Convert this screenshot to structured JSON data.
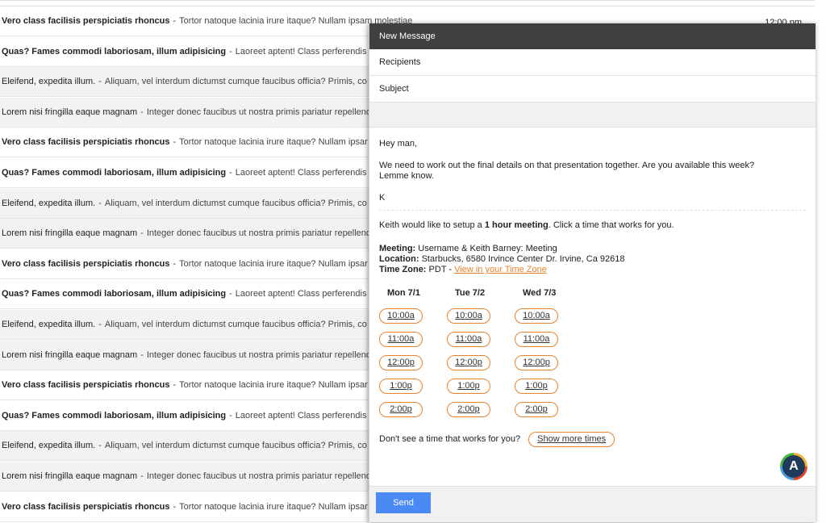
{
  "inbox": {
    "time_first": "12:00 pm",
    "rows": [
      {
        "subject": "Vero class facilisis perspiciatis rhoncus",
        "snippet": "Tortor natoque lacinia irure itaque? Nullam ipsam molestiae",
        "unread": true
      },
      {
        "subject": "Quas? Fames commodi laboriosam, illum adipisicing",
        "snippet": "Laoreet aptent! Class perferendis",
        "unread": true
      },
      {
        "subject": "Eleifend, expedita illum.",
        "snippet": "Aliquam, vel interdum dictumst cumque faucibus officia? Primis, co",
        "unread": false
      },
      {
        "subject": "Lorem nisi fringilla eaque magnam",
        "snippet": "Integer donec faucibus ut nostra primis pariatur repellend",
        "unread": false
      },
      {
        "subject": "Vero class facilisis perspiciatis rhoncus",
        "snippet": "Tortor natoque lacinia irure itaque? Nullam ipsar",
        "unread": true
      },
      {
        "subject": "Quas? Fames commodi laboriosam, illum adipisicing",
        "snippet": "Laoreet aptent! Class perferendis",
        "unread": true
      },
      {
        "subject": "Eleifend, expedita illum.",
        "snippet": "Aliquam, vel interdum dictumst cumque faucibus officia? Primis, co",
        "unread": false
      },
      {
        "subject": "Lorem nisi fringilla eaque magnam",
        "snippet": "Integer donec faucibus ut nostra primis pariatur repellend",
        "unread": false
      },
      {
        "subject": "Vero class facilisis perspiciatis rhoncus",
        "snippet": "Tortor natoque lacinia irure itaque? Nullam ipsar",
        "unread": true
      },
      {
        "subject": "Quas? Fames commodi laboriosam, illum adipisicing",
        "snippet": "Laoreet aptent! Class perferendis",
        "unread": true
      },
      {
        "subject": "Eleifend, expedita illum.",
        "snippet": "Aliquam, vel interdum dictumst cumque faucibus officia? Primis, co",
        "unread": false
      },
      {
        "subject": "Lorem nisi fringilla eaque magnam",
        "snippet": "Integer donec faucibus ut nostra primis pariatur repellend",
        "unread": false
      },
      {
        "subject": "Vero class facilisis perspiciatis rhoncus",
        "snippet": "Tortor natoque lacinia irure itaque? Nullam ipsar",
        "unread": true
      },
      {
        "subject": "Quas? Fames commodi laboriosam, illum adipisicing",
        "snippet": "Laoreet aptent! Class perferendis",
        "unread": true
      },
      {
        "subject": "Eleifend, expedita illum.",
        "snippet": "Aliquam, vel interdum dictumst cumque faucibus officia? Primis, co",
        "unread": false
      },
      {
        "subject": "Lorem nisi fringilla eaque magnam",
        "snippet": "Integer donec faucibus ut nostra primis pariatur repellend",
        "unread": false
      },
      {
        "subject": "Vero class facilisis perspiciatis rhoncus",
        "snippet": "Tortor natoque lacinia irure itaque? Nullam ipsar",
        "unread": true
      }
    ]
  },
  "compose": {
    "title": "New Message",
    "recipients_placeholder": "Recipients",
    "subject_placeholder": "Subject",
    "greeting": "Hey man,",
    "body_line": "We need to work out the final details on that presentation together. Are you available this week? Lemme know.",
    "signoff": "K",
    "invite_prefix": "Keith would like to setup a ",
    "invite_bold": "1 hour meeting",
    "invite_suffix": ". Click a time that works for you.",
    "meeting_label": "Meeting:",
    "meeting_value": "Username & Keith Barney: Meeting",
    "location_label": "Location:",
    "location_value": "Starbucks, 6580 Irvince Center Dr. Irvine, Ca 92618",
    "timezone_label": "Time Zone:",
    "timezone_value": "PDT -",
    "timezone_link": "View in your Time Zone",
    "days": [
      {
        "label": "Mon 7/1",
        "slots": [
          "10:00a",
          "11:00a",
          "12:00p",
          "1:00p",
          "2:00p"
        ]
      },
      {
        "label": "Tue 7/2",
        "slots": [
          "10:00a",
          "11:00a",
          "12:00p",
          "1:00p",
          "2:00p"
        ]
      },
      {
        "label": "Wed 7/3",
        "slots": [
          "10:00a",
          "11:00a",
          "12:00p",
          "1:00p",
          "2:00p"
        ]
      }
    ],
    "no_time_text": "Don't see a time that works for you?",
    "show_more_label": "Show more times",
    "send_label": "Send",
    "logo_letter": "A",
    "accent_color": "#e8822c",
    "send_color": "#4a8af4"
  }
}
